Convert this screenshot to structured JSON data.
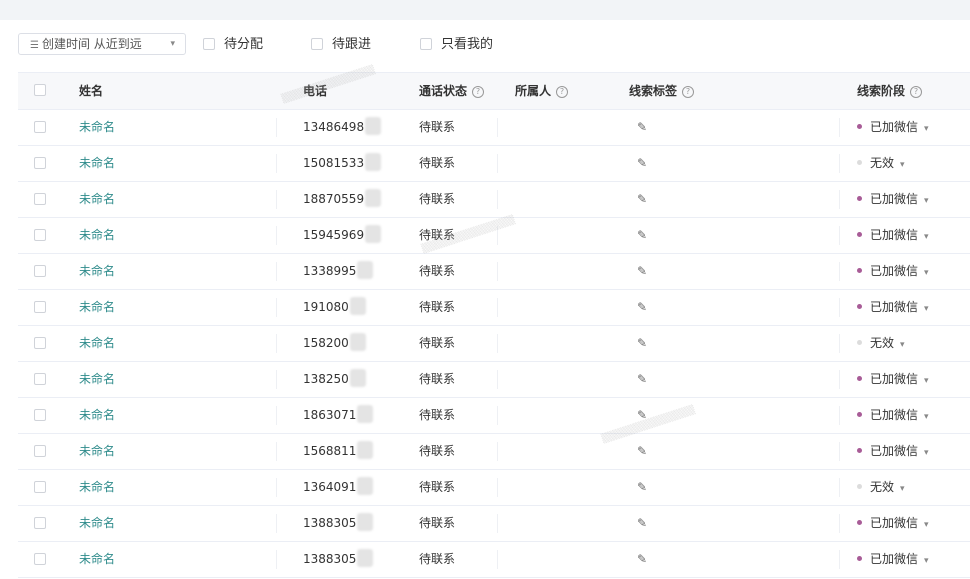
{
  "filters": {
    "sort_label": "创建时间 从近到远",
    "checks": [
      {
        "label": "待分配",
        "checked": false
      },
      {
        "label": "待跟进",
        "checked": false
      },
      {
        "label": "只看我的",
        "checked": false
      }
    ]
  },
  "table": {
    "columns": {
      "name": "姓名",
      "phone": "电话",
      "call_status": "通话状态",
      "owner": "所属人",
      "tags": "线索标签",
      "stage": "线索阶段"
    },
    "rows": [
      {
        "name": "未命名",
        "phone": "13486498",
        "status": "待联系",
        "stage": "已加微信",
        "stage_color": "#a85c97"
      },
      {
        "name": "未命名",
        "phone": "15081533",
        "status": "待联系",
        "stage": "无效",
        "stage_color": "#dcdcdc"
      },
      {
        "name": "未命名",
        "phone": "18870559",
        "status": "待联系",
        "stage": "已加微信",
        "stage_color": "#a85c97"
      },
      {
        "name": "未命名",
        "phone": "15945969",
        "status": "待联系",
        "stage": "已加微信",
        "stage_color": "#a85c97"
      },
      {
        "name": "未命名",
        "phone": "1338995",
        "status": "待联系",
        "stage": "已加微信",
        "stage_color": "#a85c97"
      },
      {
        "name": "未命名",
        "phone": "191080",
        "status": "待联系",
        "stage": "已加微信",
        "stage_color": "#a85c97"
      },
      {
        "name": "未命名",
        "phone": "158200",
        "status": "待联系",
        "stage": "无效",
        "stage_color": "#dcdcdc"
      },
      {
        "name": "未命名",
        "phone": "138250",
        "status": "待联系",
        "stage": "已加微信",
        "stage_color": "#a85c97"
      },
      {
        "name": "未命名",
        "phone": "1863071",
        "status": "待联系",
        "stage": "已加微信",
        "stage_color": "#a85c97"
      },
      {
        "name": "未命名",
        "phone": "1568811",
        "status": "待联系",
        "stage": "已加微信",
        "stage_color": "#a85c97"
      },
      {
        "name": "未命名",
        "phone": "1364091",
        "status": "待联系",
        "stage": "无效",
        "stage_color": "#dcdcdc"
      },
      {
        "name": "未命名",
        "phone": "1388305",
        "status": "待联系",
        "stage": "已加微信",
        "stage_color": "#a85c97"
      },
      {
        "name": "未命名",
        "phone": "1388305",
        "status": "待联系",
        "stage": "已加微信",
        "stage_color": "#a85c97"
      }
    ]
  }
}
